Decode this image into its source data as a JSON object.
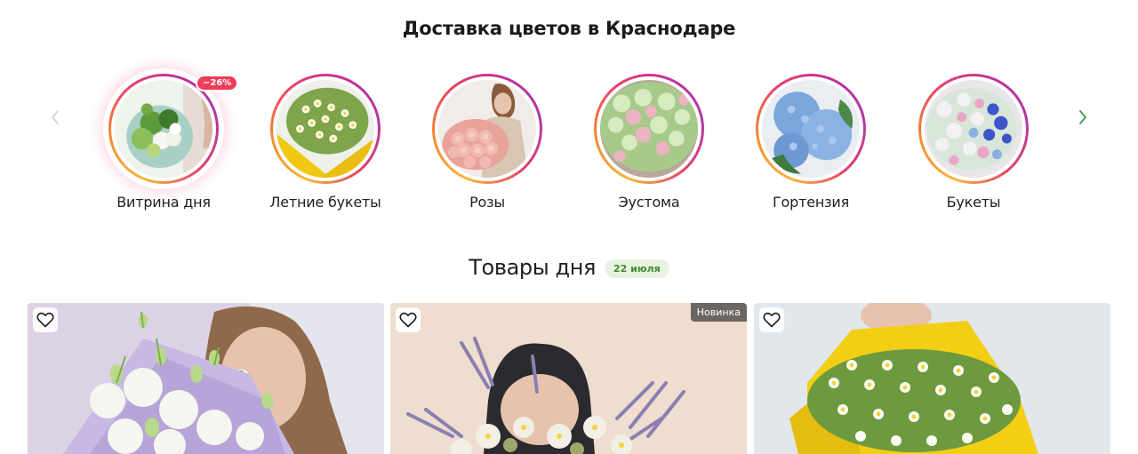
{
  "page": {
    "title": "Доставка цветов в Краснодаре"
  },
  "carousel": {
    "prev_icon": "chevron-left-icon",
    "next_icon": "chevron-right-icon",
    "colors": {
      "ring_start": "#f6b63b",
      "ring_mid": "#e9406a",
      "ring_end": "#b03aa4",
      "arrow": "#3b9b4b"
    },
    "items": [
      {
        "label": "Витрина дня",
        "badge": "−26%"
      },
      {
        "label": "Летние букеты"
      },
      {
        "label": "Розы"
      },
      {
        "label": "Эустома"
      },
      {
        "label": "Гортензия"
      },
      {
        "label": "Букеты"
      }
    ]
  },
  "products_section": {
    "title": "Товары дня",
    "date_badge": "22 июля",
    "colors": {
      "badge_bg": "#e8f3e2",
      "badge_text": "#3f8a2e"
    },
    "cards": [
      {
        "favorite_icon": "heart-outline-icon",
        "badge": ""
      },
      {
        "favorite_icon": "heart-outline-icon",
        "badge": "Новинка"
      },
      {
        "favorite_icon": "heart-outline-icon",
        "badge": ""
      }
    ]
  }
}
